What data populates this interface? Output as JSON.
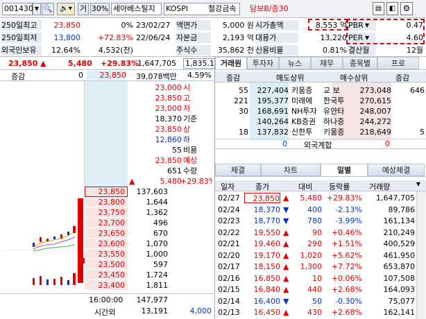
{
  "toolbar": {
    "code": "001430",
    "type": "거",
    "pct": "30%",
    "name": "세아베스틸지",
    "market": "KOSPI",
    "sector": "철강금속",
    "margin": "담보B/증30"
  },
  "info": [
    {
      "a": "250일최고",
      "b": "23,850",
      "bc": "r",
      "c": "0%",
      "d": "23/02/27",
      "e": "액면가",
      "f": "5,000 원",
      "g": "시가총액",
      "h": "8,553 억",
      "i": "PBR",
      "j": "0.47"
    },
    {
      "a": "250일최저",
      "b": "13,800",
      "bc": "b",
      "c": "+72.83%",
      "cc": "r",
      "d": "22/06/24",
      "e": "자본금",
      "f": "2,193 억",
      "g": "대용가",
      "h": "13,220",
      "i": "PER",
      "j": "4.60"
    },
    {
      "a": "외국인보유",
      "b": "12.64%",
      "bc": "k",
      "c": "4,532(천)",
      "d": "",
      "e": "주식수",
      "f": "35,862 천",
      "g": "신용비율",
      "h": "0.81%",
      "i": "결산월",
      "j": "12월"
    }
  ],
  "price": {
    "cur": "23,850",
    "arrow": "▲",
    "diff": "5,480",
    "rate": "+29.83%",
    "vol": "1,647,705",
    "extra": "1,835.1"
  },
  "ob_head": {
    "l": "증감",
    "lv": "0",
    "p": "23,850",
    "amt": "39,078백만",
    "pct": "4.59%"
  },
  "summary": [
    {
      "v": "23,000",
      "l": "시",
      "c": "r"
    },
    {
      "v": "23,850",
      "l": "고",
      "c": "r"
    },
    {
      "v": "23,000",
      "l": "저",
      "c": "r"
    },
    {
      "v": "18,370",
      "l": "기준",
      "c": "k"
    },
    {
      "v": "23,850",
      "l": "상",
      "c": "r"
    },
    {
      "v": "12,860",
      "l": "하",
      "c": "b"
    },
    {
      "v": "55",
      "l": "비용",
      "c": "k"
    },
    {
      "v": "23,850",
      "l": "예상",
      "c": "r"
    },
    {
      "v": "651",
      "l": "수량",
      "c": "k"
    },
    {
      "v": "5,480",
      "l": "+29.83%",
      "c": "r",
      "arrow": "▲"
    }
  ],
  "asks": [
    {
      "p": "23,850",
      "q": "137,603"
    },
    {
      "p": "23,800",
      "q": "1,644"
    },
    {
      "p": "23,750",
      "q": "1,362"
    },
    {
      "p": "23,700",
      "q": "496"
    },
    {
      "p": "23,650",
      "q": "670"
    },
    {
      "p": "23,600",
      "q": "1,070"
    },
    {
      "p": "23,550",
      "q": "1,000"
    },
    {
      "p": "23,500",
      "q": "597"
    },
    {
      "p": "23,450",
      "q": "1,724"
    },
    {
      "p": "23,400",
      "q": "1,811"
    }
  ],
  "ob_foot": {
    "time": "16:00:00",
    "total": "147,977",
    "after": "시간외",
    "after_q": "13,191",
    "after_r": "4,000"
  },
  "tabs1": [
    "거래원",
    "투자자",
    "뉴스",
    "재무",
    "종목별",
    "프로"
  ],
  "broker_head": [
    "증감",
    "매도상위",
    "매수상위",
    "증감"
  ],
  "brokers": [
    {
      "a": "55",
      "b": "227,404",
      "c": "키움증",
      "d": "교 보",
      "e": "273,048",
      "f": "646"
    },
    {
      "a": "221",
      "b": "195,377",
      "c": "미래에",
      "d": "한국투",
      "e": "270,615",
      "f": ""
    },
    {
      "a": "30",
      "b": "168,691",
      "c": "NH투자",
      "d": "유안타",
      "e": "248,007",
      "f": ""
    },
    {
      "a": "",
      "b": "140,264",
      "c": "KB증권",
      "d": "하나증",
      "e": "244,272",
      "f": ""
    },
    {
      "a": "18",
      "b": "137,832",
      "c": "신한투",
      "d": "키움증",
      "e": "218,649",
      "f": "5"
    }
  ],
  "foreign": {
    "l": "0",
    "label": "외국계합",
    "r": "0"
  },
  "tabs2": [
    "체결",
    "차트",
    "일별",
    "예상체결"
  ],
  "daily_head": [
    "일자",
    "종가",
    "대비",
    "등락률",
    "거래량"
  ],
  "daily": [
    {
      "d": "02/27",
      "p": "23,850",
      "s": "▲",
      "pc": "r",
      "c": "5,480",
      "r": "+29.83%",
      "v": "1,647,705",
      "hl": true,
      "up": true
    },
    {
      "d": "02/24",
      "p": "18,370",
      "s": "▼",
      "pc": "b",
      "c": "400",
      "r": "-2.13%",
      "v": "89,786"
    },
    {
      "d": "02/23",
      "p": "18,770",
      "s": "▼",
      "pc": "b",
      "c": "780",
      "r": "-3.99%",
      "v": "161,134"
    },
    {
      "d": "02/22",
      "p": "19,550",
      "s": "▲",
      "pc": "r",
      "c": "90",
      "r": "+0.46%",
      "v": "210,249"
    },
    {
      "d": "02/21",
      "p": "19,460",
      "s": "▲",
      "pc": "r",
      "c": "290",
      "r": "+1.51%",
      "v": "400,529"
    },
    {
      "d": "02/20",
      "p": "19,170",
      "s": "▲",
      "pc": "r",
      "c": "1,020",
      "r": "+5.62%",
      "v": "461,950"
    },
    {
      "d": "02/17",
      "p": "18,150",
      "s": "▲",
      "pc": "r",
      "c": "1,300",
      "r": "+7.72%",
      "v": "653,870"
    },
    {
      "d": "02/16",
      "p": "16,850",
      "s": "▲",
      "pc": "r",
      "c": "10",
      "r": "+0.06%",
      "v": "107,508"
    },
    {
      "d": "02/15",
      "p": "16,840",
      "s": "▲",
      "pc": "r",
      "c": "440",
      "r": "+2.68%",
      "v": "164,093"
    },
    {
      "d": "02/14",
      "p": "16,400",
      "s": "▼",
      "pc": "b",
      "c": "50",
      "r": "-0.30%",
      "v": "75,077"
    },
    {
      "d": "02/13",
      "p": "16,450",
      "s": "▲",
      "pc": "r",
      "c": "430",
      "r": "+2.68%",
      "v": "162,141"
    }
  ],
  "colors": {
    "up": "#e00000",
    "down": "#0030d0",
    "label_bg": "#e6ebf3",
    "ask_bg": "#ddeef7",
    "highlight": "#e00000"
  }
}
